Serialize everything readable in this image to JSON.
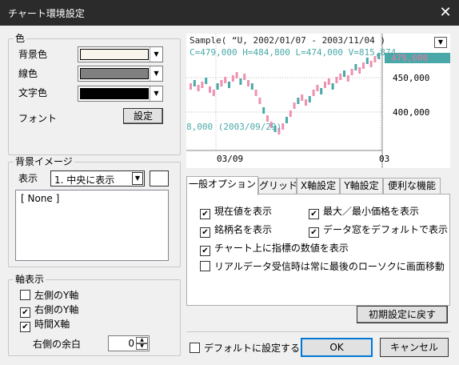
{
  "window": {
    "title": "チャート環境設定",
    "close_glyph": "✕"
  },
  "colors_group": {
    "title": "色",
    "background_label": "背景色",
    "background_color": "#f8f6ec",
    "line_label": "線色",
    "line_color": "#808080",
    "text_label": "文字色",
    "text_color": "#000000",
    "font_label": "フォント",
    "font_button": "設定"
  },
  "bg_image_group": {
    "title": "背景イメージ",
    "display_label": "表示",
    "display_value": "1. 中央に表示",
    "list_items": [
      "[ None ]"
    ]
  },
  "axis_group": {
    "title": "軸表示",
    "left_y": {
      "label": "左側のY軸",
      "checked": false
    },
    "right_y": {
      "label": "右側のY軸",
      "checked": true
    },
    "time_x": {
      "label": "時間X軸",
      "checked": true
    },
    "margin_label": "右側の余白",
    "margin_value": "0"
  },
  "preview": {
    "header": "Sample( “U, 2002/01/07 - 2003/11/04 )",
    "ohlc": "C=479,000 H=484,800 L=474,000 V=815,874",
    "current_tag": "479,000",
    "y_ticks": [
      "450,000",
      "400,000"
    ],
    "min_label": "8,000 (2003/09/29)",
    "x_ticks": [
      "03/09",
      "03"
    ]
  },
  "tabs": [
    "一般オプション",
    "グリッド",
    "X軸設定",
    "Y軸設定",
    "便利な機能"
  ],
  "general_options": {
    "show_current": {
      "label": "現在値を表示",
      "checked": true
    },
    "show_minmax": {
      "label": "最大／最小価格を表示",
      "checked": true
    },
    "show_name": {
      "label": "銘柄名を表示",
      "checked": true
    },
    "data_window": {
      "label": "データ窓をデフォルトで表示",
      "checked": true
    },
    "show_indicator": {
      "label": "チャート上に指標の数値を表示",
      "checked": true
    },
    "realtime_move": {
      "label": "リアルデータ受信時は常に最後のローソクに画面移動",
      "checked": false
    }
  },
  "buttons": {
    "reset": "初期設定に戻す",
    "ok": "OK",
    "cancel": "キャンセル"
  },
  "default_check": {
    "label": "デフォルトに設定する",
    "checked": false
  },
  "check_glyph": "✔",
  "dropdown_glyph": "▼"
}
